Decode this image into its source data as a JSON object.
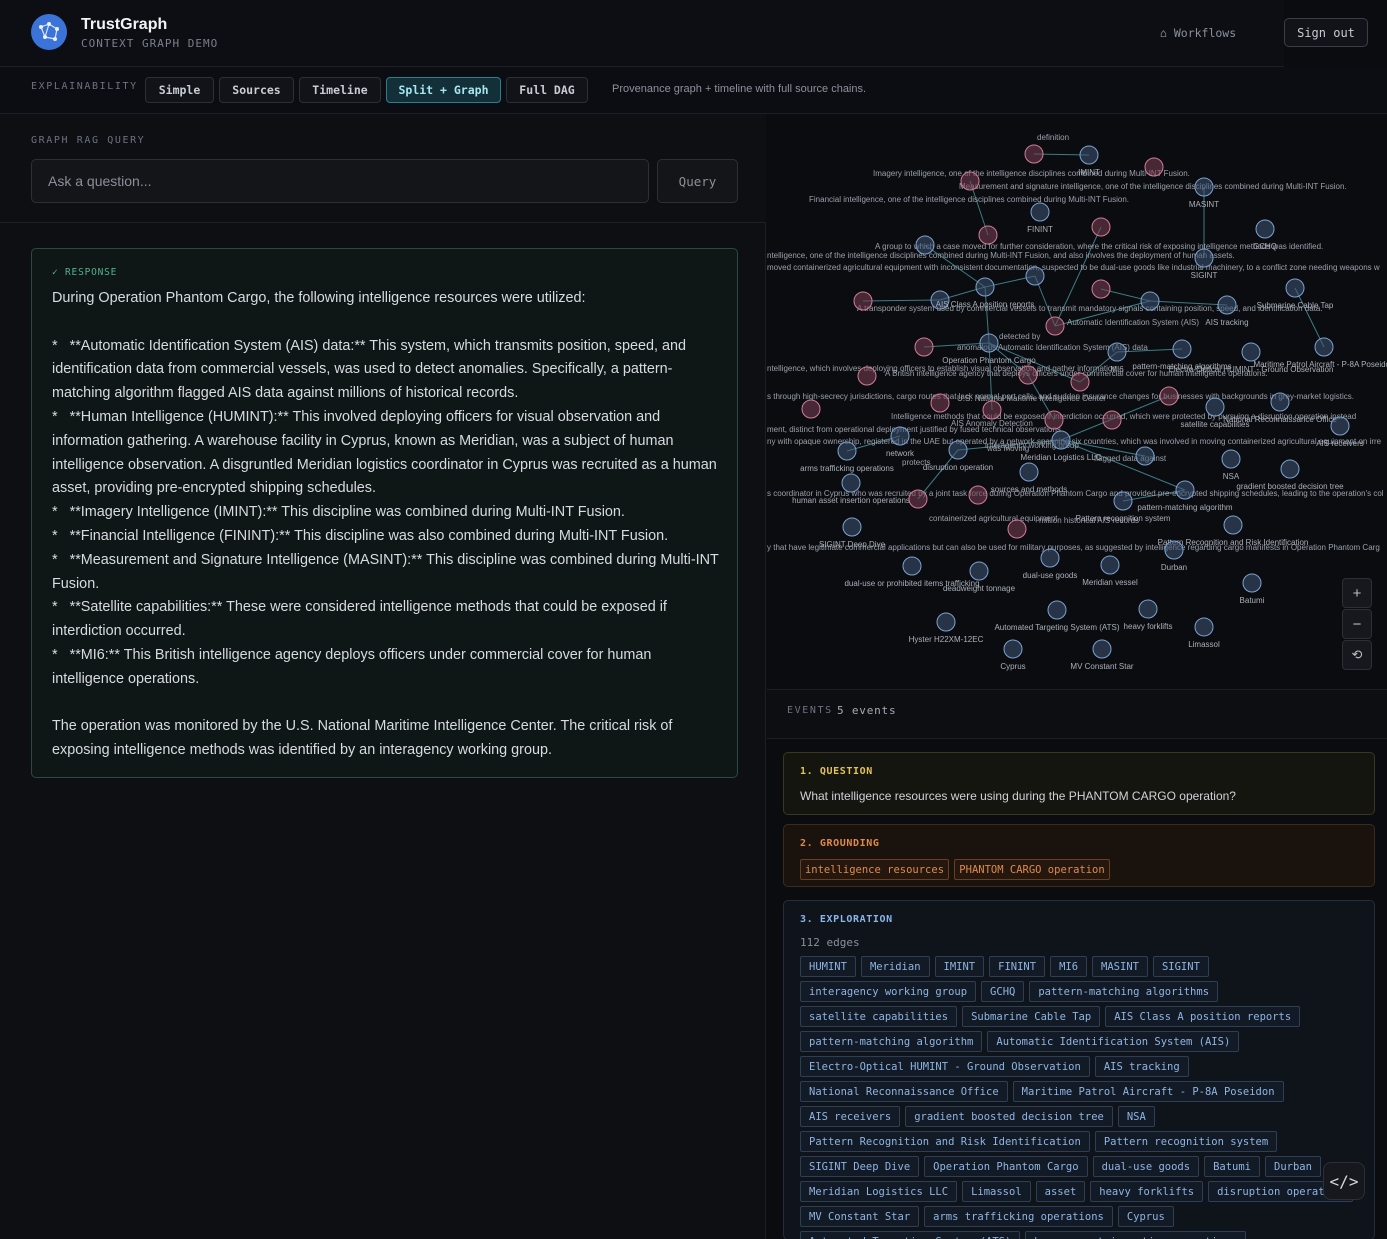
{
  "header": {
    "brand": "TrustGraph",
    "subtitle": "CONTEXT GRAPH DEMO",
    "workflows_label": "⌂ Workflows",
    "signout_label": "Sign out"
  },
  "explainability": {
    "label": "EXPLAINABILITY",
    "tabs": [
      "Simple",
      "Sources",
      "Timeline",
      "Split + Graph",
      "Full DAG"
    ],
    "active_tab": "Split + Graph",
    "description": "Provenance graph + timeline with full source chains."
  },
  "query": {
    "label": "GRAPH RAG QUERY",
    "placeholder": "Ask a question...",
    "value": "",
    "button_label": "Query"
  },
  "response": {
    "label": "✓ RESPONSE",
    "text": "During Operation Phantom Cargo, the following intelligence resources were utilized:\n\n*   **Automatic Identification System (AIS) data:** This system, which transmits position, speed, and identification data from commercial vessels, was used to detect anomalies. Specifically, a pattern-matching algorithm flagged AIS data against millions of historical records.\n*   **Human Intelligence (HUMINT):** This involved deploying officers for visual observation and information gathering. A warehouse facility in Cyprus, known as Meridian, was a subject of human intelligence observation. A disgruntled Meridian logistics coordinator in Cyprus was recruited as a human asset, providing pre-encrypted shipping schedules.\n*   **Imagery Intelligence (IMINT):** This discipline was combined during Multi-INT Fusion.\n*   **Financial Intelligence (FININT):** This discipline was also combined during Multi-INT Fusion.\n*   **Measurement and Signature Intelligence (MASINT):** This discipline was combined during Multi-INT Fusion.\n*   **Satellite capabilities:** These were considered intelligence methods that could be exposed if interdiction occurred.\n*   **MI6:** This British intelligence agency deploys officers under commercial cover for human intelligence operations.\n\nThe operation was monitored by the U.S. National Maritime Intelligence Center. The critical risk of exposing intelligence methods was identified by an interagency working group."
  },
  "graph": {
    "colors": {
      "entity": "#3f5677",
      "entity_stroke": "#7da2cf",
      "literal": "#7a3f52",
      "literal_stroke": "#d07d98",
      "edge": "#3c7c86",
      "label": "#9aa0aa"
    },
    "nodes": [
      {
        "label": "",
        "kind": "literal"
      },
      {
        "label": "IMINT",
        "kind": "entity"
      },
      {
        "label": "",
        "kind": "literal"
      },
      {
        "label": "MASINT",
        "kind": "entity"
      },
      {
        "label": "FININT",
        "kind": "entity"
      },
      {
        "label": "",
        "kind": "literal"
      },
      {
        "label": "",
        "kind": "entity"
      },
      {
        "label": "",
        "kind": "literal"
      },
      {
        "label": "",
        "kind": "literal"
      },
      {
        "label": "SIGINT",
        "kind": "entity"
      },
      {
        "label": "GCHQ",
        "kind": "entity"
      },
      {
        "label": "",
        "kind": "literal"
      },
      {
        "label": "",
        "kind": "entity"
      },
      {
        "label": "AIS Class A position reports",
        "kind": "entity"
      },
      {
        "label": "",
        "kind": "entity"
      },
      {
        "label": "",
        "kind": "literal"
      },
      {
        "label": "",
        "kind": "literal"
      },
      {
        "label": "",
        "kind": "entity"
      },
      {
        "label": "AIS tracking",
        "kind": "entity"
      },
      {
        "label": "Submarine Cable Tap",
        "kind": "entity"
      },
      {
        "label": "",
        "kind": "literal"
      },
      {
        "label": "",
        "kind": "literal"
      },
      {
        "label": "Operation Phantom Cargo",
        "kind": "entity"
      },
      {
        "label": "MI6",
        "kind": "entity"
      },
      {
        "label": "pattern-matching algorithms",
        "kind": "entity"
      },
      {
        "label": "Electro-Optical HUMINT - Ground Observation",
        "kind": "entity"
      },
      {
        "label": "Maritime Patrol Aircraft - P-8A Poseidon",
        "kind": "entity"
      },
      {
        "label": "",
        "kind": "literal"
      },
      {
        "label": "",
        "kind": "literal"
      },
      {
        "label": "",
        "kind": "literal"
      },
      {
        "label": "",
        "kind": "literal"
      },
      {
        "label": "",
        "kind": "literal"
      },
      {
        "label": "",
        "kind": "literal"
      },
      {
        "label": "",
        "kind": "literal"
      },
      {
        "label": "",
        "kind": "literal"
      },
      {
        "label": "satellite capabilities",
        "kind": "entity"
      },
      {
        "label": "National Reconnaissance Office",
        "kind": "entity"
      },
      {
        "label": "AIS receivers",
        "kind": "entity"
      },
      {
        "label": "arms trafficking operations",
        "kind": "entity"
      },
      {
        "label": "network",
        "kind": "entity"
      },
      {
        "label": "disruption operation",
        "kind": "entity"
      },
      {
        "label": "Meridian Logistics LLC",
        "kind": "entity"
      },
      {
        "label": "",
        "kind": "entity"
      },
      {
        "label": "NSA",
        "kind": "entity"
      },
      {
        "label": "gradient boosted decision tree",
        "kind": "entity"
      },
      {
        "label": "human asset insertion operations",
        "kind": "entity"
      },
      {
        "label": "",
        "kind": "literal"
      },
      {
        "label": "",
        "kind": "literal"
      },
      {
        "label": "pattern-matching algorithm",
        "kind": "entity"
      },
      {
        "label": "Pattern recognition system",
        "kind": "entity"
      },
      {
        "label": "sources and methods",
        "kind": "entity"
      },
      {
        "label": "",
        "kind": "literal"
      },
      {
        "label": "SIGINT Deep Dive",
        "kind": "entity"
      },
      {
        "label": "Pattern Recognition and Risk Identification",
        "kind": "entity"
      },
      {
        "label": "dual-use goods",
        "kind": "entity"
      },
      {
        "label": "Durban",
        "kind": "entity"
      },
      {
        "label": "dual-use or prohibited items trafficking",
        "kind": "entity"
      },
      {
        "label": "deadweight tonnage",
        "kind": "entity"
      },
      {
        "label": "Meridian vessel",
        "kind": "entity"
      },
      {
        "label": "Batumi",
        "kind": "entity"
      },
      {
        "label": "Automated Targeting System (ATS)",
        "kind": "entity"
      },
      {
        "label": "heavy forklifts",
        "kind": "entity"
      },
      {
        "label": "Limassol",
        "kind": "entity"
      },
      {
        "label": "Hyster H22XM-12EC",
        "kind": "entity"
      },
      {
        "label": "Cyprus",
        "kind": "entity"
      },
      {
        "label": "MV Constant Star",
        "kind": "entity"
      }
    ],
    "floating_labels": [
      "definition",
      "Imagery intelligence, one of the intelligence disciplines combined during Multi-INT Fusion.",
      "Measurement and signature intelligence, one of the intelligence disciplines combined during Multi-INT Fusion.",
      "Financial intelligence, one of the intelligence disciplines combined during Multi-INT Fusion.",
      "A group to which a case moved for further consideration, where the critical risk of exposing intelligence methods was identified.",
      "ntelligence, one of the intelligence disciplines combined during Multi-INT Fusion, and also involves the deployment of human assets.",
      "moved containerized agricultural equipment with inconsistent documentation, suspected to be dual-use goods like industrial machinery, to a conflict zone needing weapons w",
      "A transponder system used by commercial vessels to transmit mandatory signals containing position, speed, and identification data.",
      "A British intelligence agency that deploys officers under commercial cover for human intelligence operations.",
      "ntelligence, which involves deploying officers to establish visual observation and gather information",
      "s coordinator in Cyprus who was recruited by a joint task force during Operation Phantom Cargo and provided pre-encrypted shipping schedules, leading to the operation's col",
      "y that have legitimate commercial applications but can also be used for military purposes, as suggested by intelligence regarding cargo manifests in Operation Phantom Carg",
      "Intelligence methods that could be exposed if interdiction occurred, which were protected by pursuing a disruption operation instead",
      "ment, distinct from operational deployment justified by fused technical observations",
      "ny with opaque ownership, registered in the UAE but operated by a network spanning six countries, which was involved in moving containerized agricultural equipment on irre",
      "s through high-secrecy jurisdictions, cargo routes that lack normal port calls, and sudden insurance changes for businesses with backgrounds in grey-market logistics.",
      "anomalous Automatic Identification System (AIS) data",
      "U.S. National Maritime Intelligence Center",
      "AIS Anomaly Detection",
      "containerized agricultural equipment",
      "million historical AIS records",
      "interagency working group",
      "Automatic Identification System (AIS)",
      "detected by",
      "was moving",
      "flagged data against",
      "protects"
    ]
  },
  "zoom": {
    "zoom_in": "+",
    "zoom_out": "−",
    "reset": "⟲"
  },
  "events": {
    "label": "EVENTS",
    "count": "5 events",
    "question": {
      "title": "1. QUESTION",
      "text": "What intelligence resources were using during the PHANTOM CARGO operation?"
    },
    "grounding": {
      "title": "2. GROUNDING",
      "tags": [
        "intelligence resources",
        "PHANTOM CARGO operation"
      ]
    },
    "exploration": {
      "title": "3. EXPLORATION",
      "edges": "112 edges",
      "tags": [
        "HUMINT",
        "Meridian",
        "IMINT",
        "FININT",
        "MI6",
        "MASINT",
        "SIGINT",
        "interagency working group",
        "GCHQ",
        "pattern-matching algorithms",
        "satellite capabilities",
        "Submarine Cable Tap",
        "AIS Class A position reports",
        "pattern-matching algorithm",
        "Automatic Identification System (AIS)",
        "Electro-Optical HUMINT - Ground Observation",
        "AIS tracking",
        "National Reconnaissance Office",
        "Maritime Patrol Aircraft - P-8A Poseidon",
        "AIS receivers",
        "gradient boosted decision tree",
        "NSA",
        "Pattern Recognition and Risk Identification",
        "Pattern recognition system",
        "SIGINT Deep Dive",
        "Operation Phantom Cargo",
        "dual-use goods",
        "Batumi",
        "Durban",
        "Meridian Logistics LLC",
        "Limassol",
        "asset",
        "heavy forklifts",
        "disruption operation",
        "MV Constant Star",
        "arms trafficking operations",
        "Cyprus",
        "Automated Targeting System (ATS)",
        "human asset insertion operations",
        "Hyster H22XM-12EC"
      ]
    }
  },
  "code_button": "</>"
}
